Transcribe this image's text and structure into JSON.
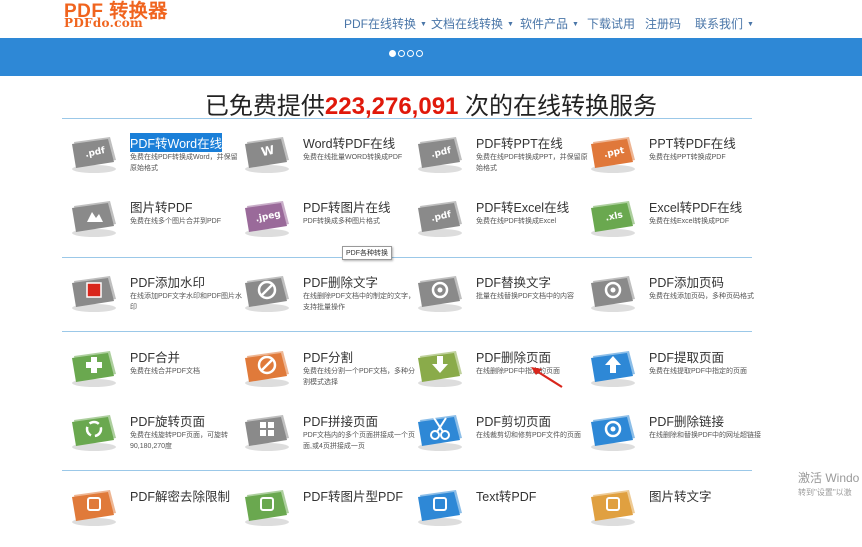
{
  "logo": {
    "main": "PDF 转换器",
    "sub": "PDFdo.com"
  },
  "nav": [
    {
      "label": "PDF在线转换",
      "dropdown": true
    },
    {
      "label": "文档在线转换",
      "dropdown": true
    },
    {
      "label": "软件产品",
      "dropdown": true
    },
    {
      "label": "下载试用",
      "dropdown": false
    },
    {
      "label": "注册码",
      "dropdown": false
    },
    {
      "label": "联系我们",
      "dropdown": true
    }
  ],
  "banner": {
    "slides": 4,
    "active_slide": 1
  },
  "headline": {
    "before": "已免费提供",
    "count": "223,276,091",
    "after": " 次的在线转换服务"
  },
  "tooltip": "PDF各种转换",
  "tools": [
    {
      "title": "PDF转Word在线",
      "desc": "免费在线PDF转换成Word，并保留原始格式",
      "icon": "pdf-document-icon",
      "icon_text": ".pdf",
      "color": "#8a8a8a",
      "selected": true
    },
    {
      "title": "Word转PDF在线",
      "desc": "免费在线批量WORD转换成PDF",
      "icon": "word-document-icon",
      "icon_text": "W",
      "color": "#8a8a8a"
    },
    {
      "title": "PDF转PPT在线",
      "desc": "免费在线PDF转换成PPT，并保留原始格式",
      "icon": "pdf-document-icon",
      "icon_text": ".pdf",
      "color": "#8a8a8a"
    },
    {
      "title": "PPT转PDF在线",
      "desc": "免费在线PPT转换成PDF",
      "icon": "ppt-document-icon",
      "icon_text": ".ppt",
      "color": "#e0783a"
    },
    {
      "title": "图片转PDF",
      "desc": "免费在线多个图片合并到PDF",
      "icon": "image-document-icon",
      "icon_text": "",
      "color": "#8a8a8a"
    },
    {
      "title": "PDF转图片在线",
      "desc": "PDF转换成多种图片格式",
      "icon": "jpeg-document-icon",
      "icon_text": ".jpeg",
      "color": "#9a6a9a"
    },
    {
      "title": "PDF转Excel在线",
      "desc": "免费在线PDF转换成Excel",
      "icon": "pdf-document-icon",
      "icon_text": ".pdf",
      "color": "#8a8a8a"
    },
    {
      "title": "Excel转PDF在线",
      "desc": "免费在线Excel转换成PDF",
      "icon": "excel-document-icon",
      "icon_text": ".xls",
      "color": "#6aa84f"
    },
    {
      "title": "PDF添加水印",
      "desc": "在线添加PDF文字水印和PDF图片水印",
      "icon": "watermark-icon",
      "icon_text": "",
      "color": "#8a8a8a"
    },
    {
      "title": "PDF删除文字",
      "desc": "在线删除PDF文档中的制定的文字，支持批量操作",
      "icon": "delete-text-icon",
      "icon_text": "",
      "color": "#8a8a8a"
    },
    {
      "title": "PDF替换文字",
      "desc": "批量在线替换PDF文档中的内容",
      "icon": "replace-text-icon",
      "icon_text": "",
      "color": "#8a8a8a"
    },
    {
      "title": "PDF添加页码",
      "desc": "免费在线添加页码，多种页码格式",
      "icon": "page-number-icon",
      "icon_text": "",
      "color": "#8a8a8a"
    },
    {
      "title": "PDF合并",
      "desc": "免费在线合并PDF文档",
      "icon": "merge-plus-icon",
      "icon_text": "",
      "color": "#6aa84f"
    },
    {
      "title": "PDF分割",
      "desc": "免费在线分割一个PDF文档，多种分割模式选择",
      "icon": "split-minus-icon",
      "icon_text": "",
      "color": "#e07a3a"
    },
    {
      "title": "PDF删除页面",
      "desc": "在线删除PDF中指定的页面",
      "icon": "download-arrow-icon",
      "icon_text": "",
      "color": "#8aab4a"
    },
    {
      "title": "PDF提取页面",
      "desc": "免费在线提取PDF中指定的页面",
      "icon": "upload-arrow-icon",
      "icon_text": "",
      "color": "#2e88d6"
    },
    {
      "title": "PDF旋转页面",
      "desc": "免费在线旋转PDF页面，可旋转90,180,270度",
      "icon": "rotate-recycle-icon",
      "icon_text": "",
      "color": "#6aa84f"
    },
    {
      "title": "PDF拼接页面",
      "desc": "PDF文档内的多个页面拼接成一个页面,或4页拼接成一页",
      "icon": "grid-join-icon",
      "icon_text": "",
      "color": "#8a8a8a"
    },
    {
      "title": "PDF剪切页面",
      "desc": "在线裁剪切和修剪PDF文件的页面",
      "icon": "scissors-icon",
      "icon_text": "",
      "color": "#2e88d6"
    },
    {
      "title": "PDF删除链接",
      "desc": "在线删除和替换PDF中的网址超链接",
      "icon": "link-icon",
      "icon_text": "",
      "color": "#2e88d6"
    },
    {
      "title": "PDF解密去除限制",
      "desc": "",
      "icon": "unlock-icon",
      "icon_text": "",
      "color": "#e07a3a"
    },
    {
      "title": "PDF转图片型PDF",
      "desc": "",
      "icon": "image-pdf-icon",
      "icon_text": "",
      "color": "#6aa84f"
    },
    {
      "title": "Text转PDF",
      "desc": "",
      "icon": "text-document-icon",
      "icon_text": "",
      "color": "#2e88d6"
    },
    {
      "title": "图片转文字",
      "desc": "",
      "icon": "ocr-icon",
      "icon_text": "",
      "color": "#e0a040"
    }
  ],
  "watermark": {
    "line1": "激活 Windo",
    "line2": "转到\"设置\"以激"
  }
}
